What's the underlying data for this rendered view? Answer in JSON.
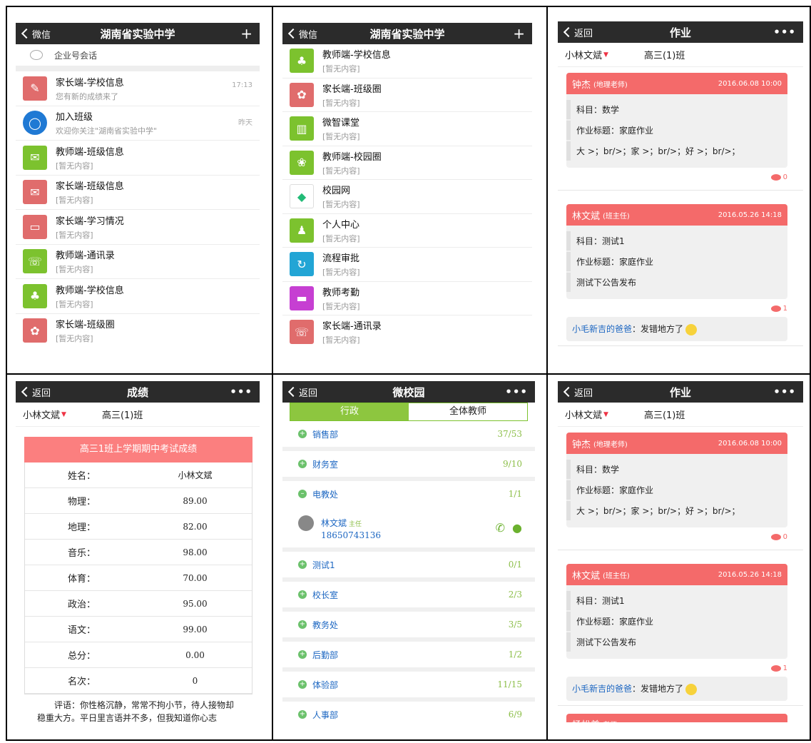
{
  "panel1": {
    "back": "微信",
    "title": "湖南省实验中学",
    "plus": "+",
    "enterprise": "企业号会话",
    "items": [
      {
        "title": "家长端-学校信息",
        "sub": "您有新的成绩来了",
        "time": "17:13",
        "icon": "broom-icon",
        "color": "red"
      },
      {
        "title": "加入班级",
        "sub": "欢迎你关注\"湖南省实验中学\"",
        "time": "昨天",
        "icon": "chat-bubble-icon",
        "color": "blue"
      },
      {
        "title": "教师端-班级信息",
        "sub": "[暂无内容]",
        "time": "",
        "icon": "envelope-icon",
        "color": "green"
      },
      {
        "title": "家长端-班级信息",
        "sub": "[暂无内容]",
        "time": "",
        "icon": "envelope-icon",
        "color": "red"
      },
      {
        "title": "家长端-学习情况",
        "sub": "[暂无内容]",
        "time": "",
        "icon": "math-board-icon",
        "color": "red"
      },
      {
        "title": "教师端-通讯录",
        "sub": "[暂无内容]",
        "time": "",
        "icon": "phone-book-icon",
        "color": "green"
      },
      {
        "title": "教师端-学校信息",
        "sub": "[暂无内容]",
        "time": "",
        "icon": "signpost-icon",
        "color": "green"
      },
      {
        "title": "家长端-班级圈",
        "sub": "[暂无内容]",
        "time": "",
        "icon": "circle-icon",
        "color": "red"
      }
    ]
  },
  "panel2": {
    "back": "微信",
    "title": "湖南省实验中学",
    "plus": "+",
    "items": [
      {
        "title": "教师端-学校信息",
        "sub": "[暂无内容]",
        "icon": "signpost-icon",
        "color": "green"
      },
      {
        "title": "家长端-班级圈",
        "sub": "[暂无内容]",
        "icon": "circle-icon",
        "color": "red"
      },
      {
        "title": "微智课堂",
        "sub": "[暂无内容]",
        "icon": "books-icon",
        "color": "green"
      },
      {
        "title": "教师端-校园圈",
        "sub": "[暂无内容]",
        "icon": "flower-icon",
        "color": "green"
      },
      {
        "title": "校园网",
        "sub": "[暂无内容]",
        "icon": "school-logo-icon",
        "color": "white"
      },
      {
        "title": "个人中心",
        "sub": "[暂无内容]",
        "icon": "person-icon",
        "color": "green"
      },
      {
        "title": "流程审批",
        "sub": "[暂无内容]",
        "icon": "approval-icon",
        "color": "teal"
      },
      {
        "title": "教师考勤",
        "sub": "[暂无内容]",
        "icon": "card-icon",
        "color": "purple"
      },
      {
        "title": "家长端-通讯录",
        "sub": "[暂无内容]",
        "icon": "phone-book-icon",
        "color": "red"
      }
    ]
  },
  "homework": {
    "back": "返回",
    "title": "作业",
    "more": "•••",
    "student": "小林文斌",
    "class": "高三(1)班",
    "cards": [
      {
        "name": "钟杰",
        "role": "(地理老师)",
        "date": "2016.06.08 10:00",
        "lines": [
          "科目：数学",
          "作业标题：家庭作业",
          "大 >；br/>；家 >；br/>；好 >；br/>；"
        ],
        "comments": "0"
      },
      {
        "name": "林文斌",
        "role": "(班主任)",
        "date": "2016.05.26 14:18",
        "lines": [
          "科目：测试1",
          "作业标题：家庭作业",
          "测试下公告发布"
        ],
        "comments": "1"
      }
    ],
    "reply_name": "小毛新吉的爸爸",
    "reply_text": "：发错地方了",
    "next_name": "杨松美",
    "next_role": "老师"
  },
  "scores": {
    "back": "返回",
    "title": "成绩",
    "more": "•••",
    "student": "小林文斌",
    "class": "高三(1)班",
    "table_title": "高三1班上学期期中考试成绩",
    "rows": [
      {
        "k": "姓名：",
        "v": "小林文斌"
      },
      {
        "k": "物理：",
        "v": "89.00"
      },
      {
        "k": "地理：",
        "v": "82.00"
      },
      {
        "k": "音乐：",
        "v": "98.00"
      },
      {
        "k": "体育：",
        "v": "70.00"
      },
      {
        "k": "政治：",
        "v": "95.00"
      },
      {
        "k": "语文：",
        "v": "99.00"
      },
      {
        "k": "总分：",
        "v": "0.00"
      },
      {
        "k": "名次：",
        "v": "0"
      }
    ],
    "comment": "评语：你性格沉静，常常不拘小节，待人接物却稳重大方。平日里言语并不多，但我知道你心志"
  },
  "campus": {
    "back": "返回",
    "title": "微校园",
    "more": "•••",
    "tab_admin": "行政",
    "tab_all": "全体教师",
    "depts_top": [
      {
        "name": "销售部",
        "count": "37/53"
      },
      {
        "name": "财务室",
        "count": "9/10"
      },
      {
        "name": "电教处",
        "count": "1/1"
      }
    ],
    "member": {
      "name": "林文斌",
      "tag": "主任",
      "phone": "18650743136"
    },
    "depts_bottom": [
      {
        "name": "测试1",
        "count": "0/1"
      },
      {
        "name": "校长室",
        "count": "2/3"
      },
      {
        "name": "教务处",
        "count": "3/5"
      },
      {
        "name": "后勤部",
        "count": "1/2"
      },
      {
        "name": "体验部",
        "count": "11/15"
      },
      {
        "name": "人事部",
        "count": "6/9"
      }
    ]
  }
}
